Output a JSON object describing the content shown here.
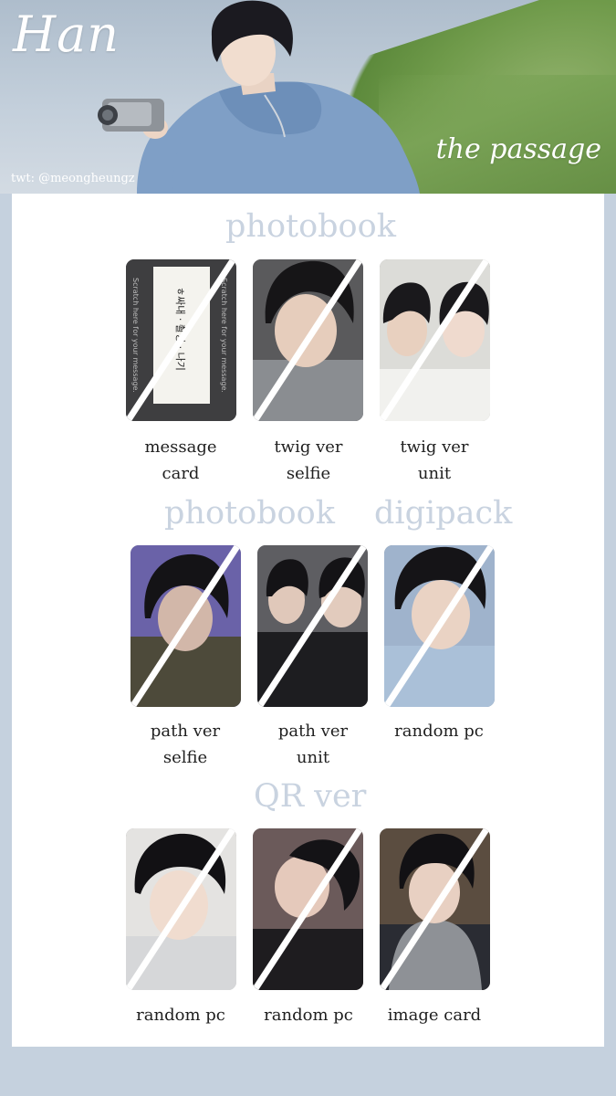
{
  "header": {
    "name": "Han",
    "album": "the passage",
    "credit": "twt: @meongheungz"
  },
  "sections": {
    "s1": "photobook",
    "s2a": "photobook",
    "s2b": "digipack",
    "s3": "QR ver"
  },
  "cards": [
    {
      "line1": "message",
      "line2": "card",
      "text_left": "Scratch here for your message.",
      "text_mid": "ㅎ싸내 · 촬영 · 나기",
      "text_right": "Scratch here for your message."
    },
    {
      "line1": "twig ver",
      "line2": "selfie"
    },
    {
      "line1": "twig ver",
      "line2": "unit"
    },
    {
      "line1": "path ver",
      "line2": "selfie"
    },
    {
      "line1": "path ver",
      "line2": "unit"
    },
    {
      "line1": "random pc",
      "line2": ""
    },
    {
      "line1": "random pc",
      "line2": ""
    },
    {
      "line1": "random pc",
      "line2": ""
    },
    {
      "line1": "image card",
      "line2": ""
    }
  ],
  "colors": {
    "background": "#c5d1de",
    "panel": "#ffffff",
    "section_title": "#c9d3e0",
    "label": "#1f1f1f"
  }
}
